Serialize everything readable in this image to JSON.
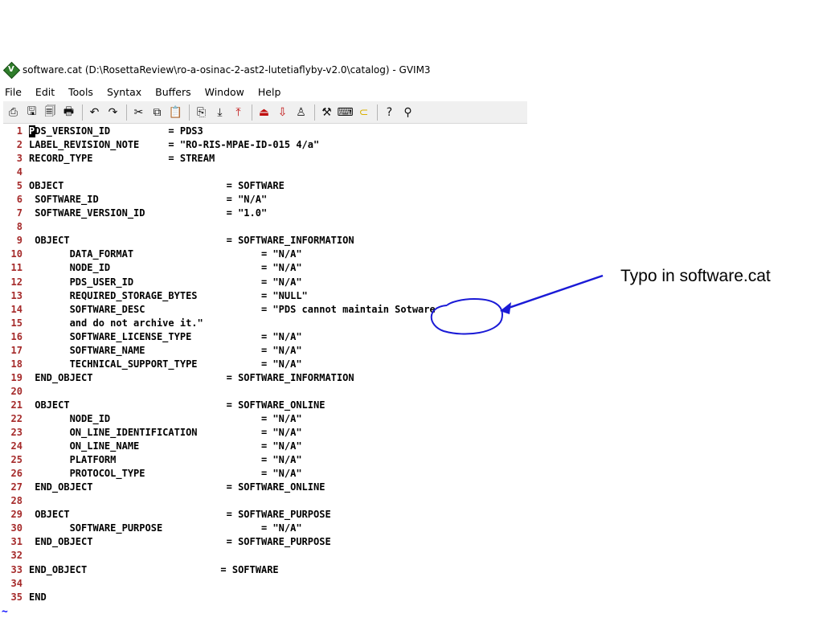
{
  "window": {
    "title": "software.cat (D:\\RosettaReview\\ro-a-osinac-2-ast2-lutetiaflyby-v2.0\\catalog) - GVIM3",
    "icon": "gvim-icon"
  },
  "menu": [
    "File",
    "Edit",
    "Tools",
    "Syntax",
    "Buffers",
    "Window",
    "Help"
  ],
  "toolbar": [
    {
      "name": "open-icon",
      "glyph": "⎙"
    },
    {
      "name": "save-icon",
      "glyph": "🖫"
    },
    {
      "name": "save-all-icon",
      "glyph": "🗐"
    },
    {
      "name": "print-icon",
      "glyph": "🖶"
    },
    {
      "sep": true
    },
    {
      "name": "undo-icon",
      "glyph": "↶"
    },
    {
      "name": "redo-icon",
      "glyph": "↷"
    },
    {
      "sep": true
    },
    {
      "name": "cut-icon",
      "glyph": "✂"
    },
    {
      "name": "copy-icon",
      "glyph": "⧉"
    },
    {
      "name": "paste-icon",
      "glyph": "📋"
    },
    {
      "sep": true
    },
    {
      "name": "replace-icon",
      "glyph": "⎘"
    },
    {
      "name": "find-next-icon",
      "glyph": "⤓"
    },
    {
      "name": "find-prev-icon",
      "glyph": "⤒"
    },
    {
      "sep": true
    },
    {
      "name": "load-session-icon",
      "glyph": "⏏"
    },
    {
      "name": "save-session-icon",
      "glyph": "⇩"
    },
    {
      "name": "run-script-icon",
      "glyph": "♙"
    },
    {
      "sep": true
    },
    {
      "name": "make-icon",
      "glyph": "⚒"
    },
    {
      "name": "shell-icon",
      "glyph": "⌨"
    },
    {
      "name": "ctags-icon",
      "glyph": "⊂"
    },
    {
      "sep": true
    },
    {
      "name": "help-icon",
      "glyph": "?"
    },
    {
      "name": "find-help-icon",
      "glyph": "⚲"
    }
  ],
  "lines": [
    {
      "n": "1",
      "t": "PDS_VERSION_ID          = PDS3"
    },
    {
      "n": "2",
      "t": "LABEL_REVISION_NOTE     = \"RO-RIS-MPAE-ID-015 4/a\""
    },
    {
      "n": "3",
      "t": "RECORD_TYPE             = STREAM"
    },
    {
      "n": "4",
      "t": ""
    },
    {
      "n": "5",
      "t": "OBJECT                            = SOFTWARE"
    },
    {
      "n": "6",
      "t": " SOFTWARE_ID                      = \"N/A\""
    },
    {
      "n": "7",
      "t": " SOFTWARE_VERSION_ID              = \"1.0\""
    },
    {
      "n": "8",
      "t": ""
    },
    {
      "n": "9",
      "t": " OBJECT                           = SOFTWARE_INFORMATION"
    },
    {
      "n": "10",
      "t": "       DATA_FORMAT                      = \"N/A\""
    },
    {
      "n": "11",
      "t": "       NODE_ID                          = \"N/A\""
    },
    {
      "n": "12",
      "t": "       PDS_USER_ID                      = \"N/A\""
    },
    {
      "n": "13",
      "t": "       REQUIRED_STORAGE_BYTES           = \"NULL\""
    },
    {
      "n": "14",
      "t": "       SOFTWARE_DESC                    = \"PDS cannot maintain Sotware"
    },
    {
      "n": "15",
      "t": "       and do not archive it.\""
    },
    {
      "n": "16",
      "t": "       SOFTWARE_LICENSE_TYPE            = \"N/A\""
    },
    {
      "n": "17",
      "t": "       SOFTWARE_NAME                    = \"N/A\""
    },
    {
      "n": "18",
      "t": "       TECHNICAL_SUPPORT_TYPE           = \"N/A\""
    },
    {
      "n": "19",
      "t": " END_OBJECT                       = SOFTWARE_INFORMATION"
    },
    {
      "n": "20",
      "t": ""
    },
    {
      "n": "21",
      "t": " OBJECT                           = SOFTWARE_ONLINE"
    },
    {
      "n": "22",
      "t": "       NODE_ID                          = \"N/A\""
    },
    {
      "n": "23",
      "t": "       ON_LINE_IDENTIFICATION           = \"N/A\""
    },
    {
      "n": "24",
      "t": "       ON_LINE_NAME                     = \"N/A\""
    },
    {
      "n": "25",
      "t": "       PLATFORM                         = \"N/A\""
    },
    {
      "n": "26",
      "t": "       PROTOCOL_TYPE                    = \"N/A\""
    },
    {
      "n": "27",
      "t": " END_OBJECT                       = SOFTWARE_ONLINE"
    },
    {
      "n": "28",
      "t": ""
    },
    {
      "n": "29",
      "t": " OBJECT                           = SOFTWARE_PURPOSE"
    },
    {
      "n": "30",
      "t": "       SOFTWARE_PURPOSE                 = \"N/A\""
    },
    {
      "n": "31",
      "t": " END_OBJECT                       = SOFTWARE_PURPOSE"
    },
    {
      "n": "32",
      "t": ""
    },
    {
      "n": "33",
      "t": "END_OBJECT                       = SOFTWARE"
    },
    {
      "n": "34",
      "t": ""
    },
    {
      "n": "35",
      "t": "END"
    }
  ],
  "tilde": "~",
  "annotation": {
    "text": "Typo in software.cat",
    "color": "#1a1ad6"
  }
}
